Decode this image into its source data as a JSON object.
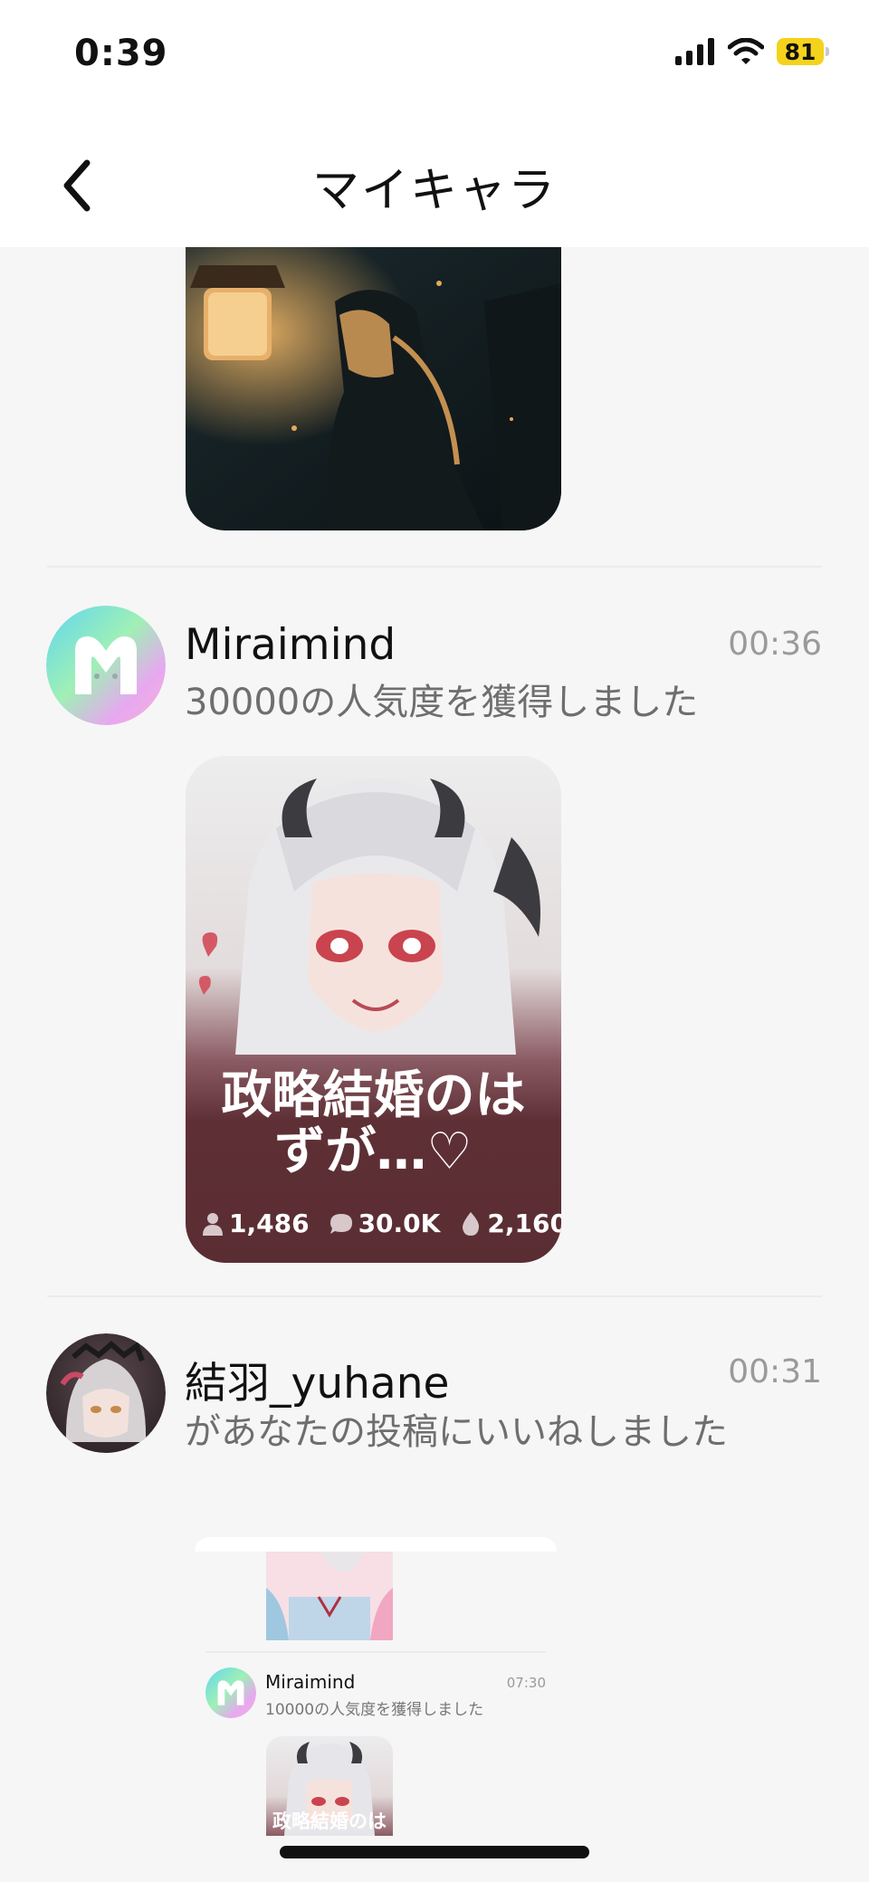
{
  "status_bar": {
    "time": "0:39",
    "battery": "81"
  },
  "header": {
    "title": "マイキャラ"
  },
  "notifications": [
    {
      "user": "Miraimind",
      "message": "30000の人気度を獲得しました",
      "time": "00:36",
      "post": {
        "title": "政略結婚のはずが…♡",
        "stats": {
          "users": "1,486",
          "chats": "30.0K",
          "likes": "2,160"
        }
      }
    },
    {
      "user": "結羽_yuhane",
      "message": "があなたの投稿にいいねしました",
      "time": "00:31"
    }
  ],
  "shared_preview": {
    "user": "Miraimind",
    "message": "10000の人気度を獲得しました",
    "time": "07:30",
    "post_title": "政略結婚のは"
  }
}
